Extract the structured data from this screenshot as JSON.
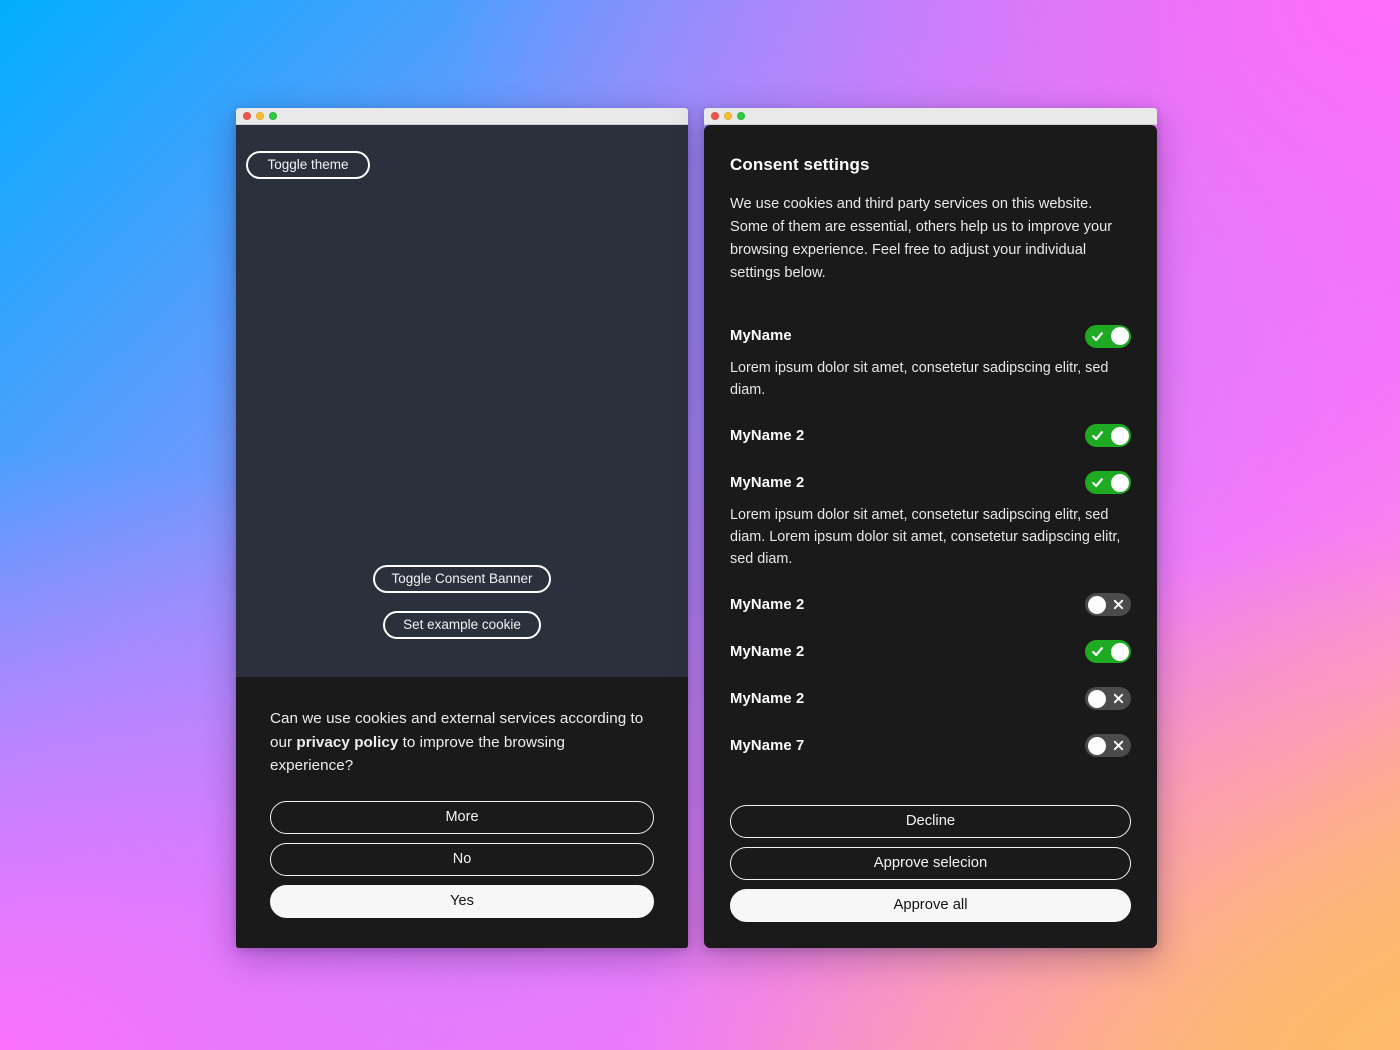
{
  "background": {
    "gradient_from": "#02aefd",
    "gradient_mid": "#ff6cf8",
    "gradient_to": "#fdbd68"
  },
  "accent": {
    "toggle_on": "#1eaa23",
    "toggle_off": "#4b4b4b",
    "surface_dark": "#1a1a1a",
    "page_dark": "#2b303d"
  },
  "left_window": {
    "traffic_lights": [
      "close-dot",
      "minimize-dot",
      "maximize-dot"
    ],
    "toggle_theme_label": "Toggle theme",
    "toggle_consent_banner_label": "Toggle Consent Banner",
    "set_example_cookie_label": "Set example cookie",
    "banner": {
      "text_before": "Can we use cookies and external services according to our ",
      "text_link": "privacy policy",
      "text_after": " to improve the browsing experience?",
      "buttons": [
        {
          "label": "More",
          "style": "ghost"
        },
        {
          "label": "No",
          "style": "ghost"
        },
        {
          "label": "Yes",
          "style": "solid"
        }
      ]
    }
  },
  "right_window": {
    "traffic_lights": [
      "close-dot",
      "minimize-dot",
      "maximize-dot"
    ],
    "title": "Consent settings",
    "intro": "We use cookies and third party services on this website. Some of them are essential, others help us to improve your browsing experience. Feel free to adjust your individual settings below.",
    "options": [
      {
        "name": "MyName",
        "description": "Lorem ipsum dolor sit amet, consetetur sadipscing elitr, sed diam.",
        "enabled": true
      },
      {
        "name": "MyName 2",
        "description": "",
        "enabled": true
      },
      {
        "name": "MyName 2",
        "description": "Lorem ipsum dolor sit amet, consetetur sadipscing elitr, sed diam. Lorem ipsum dolor sit amet, consetetur sadipscing elitr, sed diam.",
        "enabled": true
      },
      {
        "name": "MyName 2",
        "description": "",
        "enabled": false
      },
      {
        "name": "MyName 2",
        "description": "",
        "enabled": true
      },
      {
        "name": "MyName 2",
        "description": "",
        "enabled": false
      },
      {
        "name": "MyName 7",
        "description": "",
        "enabled": false
      }
    ],
    "actions": [
      {
        "label": "Decline",
        "style": "ghost"
      },
      {
        "label": "Approve selecion",
        "style": "ghost"
      },
      {
        "label": "Approve all",
        "style": "solid"
      }
    ]
  }
}
